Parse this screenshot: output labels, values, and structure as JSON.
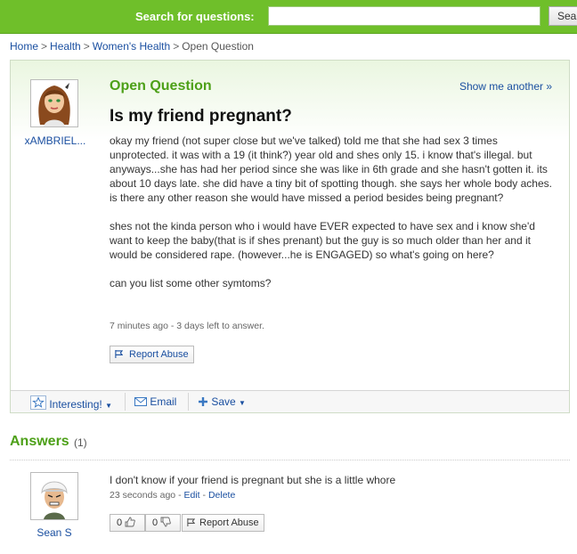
{
  "header": {
    "search_label": "Search for questions:",
    "search_value": "",
    "search_button": "Sea"
  },
  "breadcrumb": [
    "Home",
    "Health",
    "Women's Health",
    "Open Question"
  ],
  "question": {
    "asker_name": "xAMBRIEL...",
    "status": "Open Question",
    "show_another": "Show me another »",
    "title": "Is my friend pregnant?",
    "body": [
      "okay my friend (not super close but we've talked) told me that she had sex 3 times unprotected. it was with a 19 (it think?) year old and shes only 15. i know that's illegal. but anyways...she has had her period since she was like in 6th grade and she hasn't gotten it. its about 10 days late. she did have a tiny bit of spotting though. she says her whole body aches. is there any other reason she would have missed a period besides being pregnant?",
      "shes not the kinda person who i would have EVER expected to have sex and i know she'd want to keep the baby(that is if shes prenant) but the guy is so much older than her and it would be considered rape. (however...he is ENGAGED) so what's going on here?",
      "can you list some other symtoms?"
    ],
    "meta": "7 minutes ago - 3 days left to answer.",
    "report_abuse": "Report Abuse",
    "actions": {
      "interesting": "Interesting!",
      "email": "Email",
      "save": "Save"
    }
  },
  "answers": {
    "title": "Answers",
    "count": "(1)",
    "items": [
      {
        "author": "Sean S",
        "text": "I don't know if your friend is pregnant but she is a little whore",
        "time": "23 seconds ago",
        "edit": "Edit",
        "delete": "Delete",
        "thumbs_up": "0",
        "thumbs_down": "0",
        "report_abuse": "Report Abuse"
      }
    ]
  },
  "colors": {
    "brand_green": "#6fbf2a",
    "heading_green": "#4da018",
    "link_blue": "#1a4fa0"
  }
}
